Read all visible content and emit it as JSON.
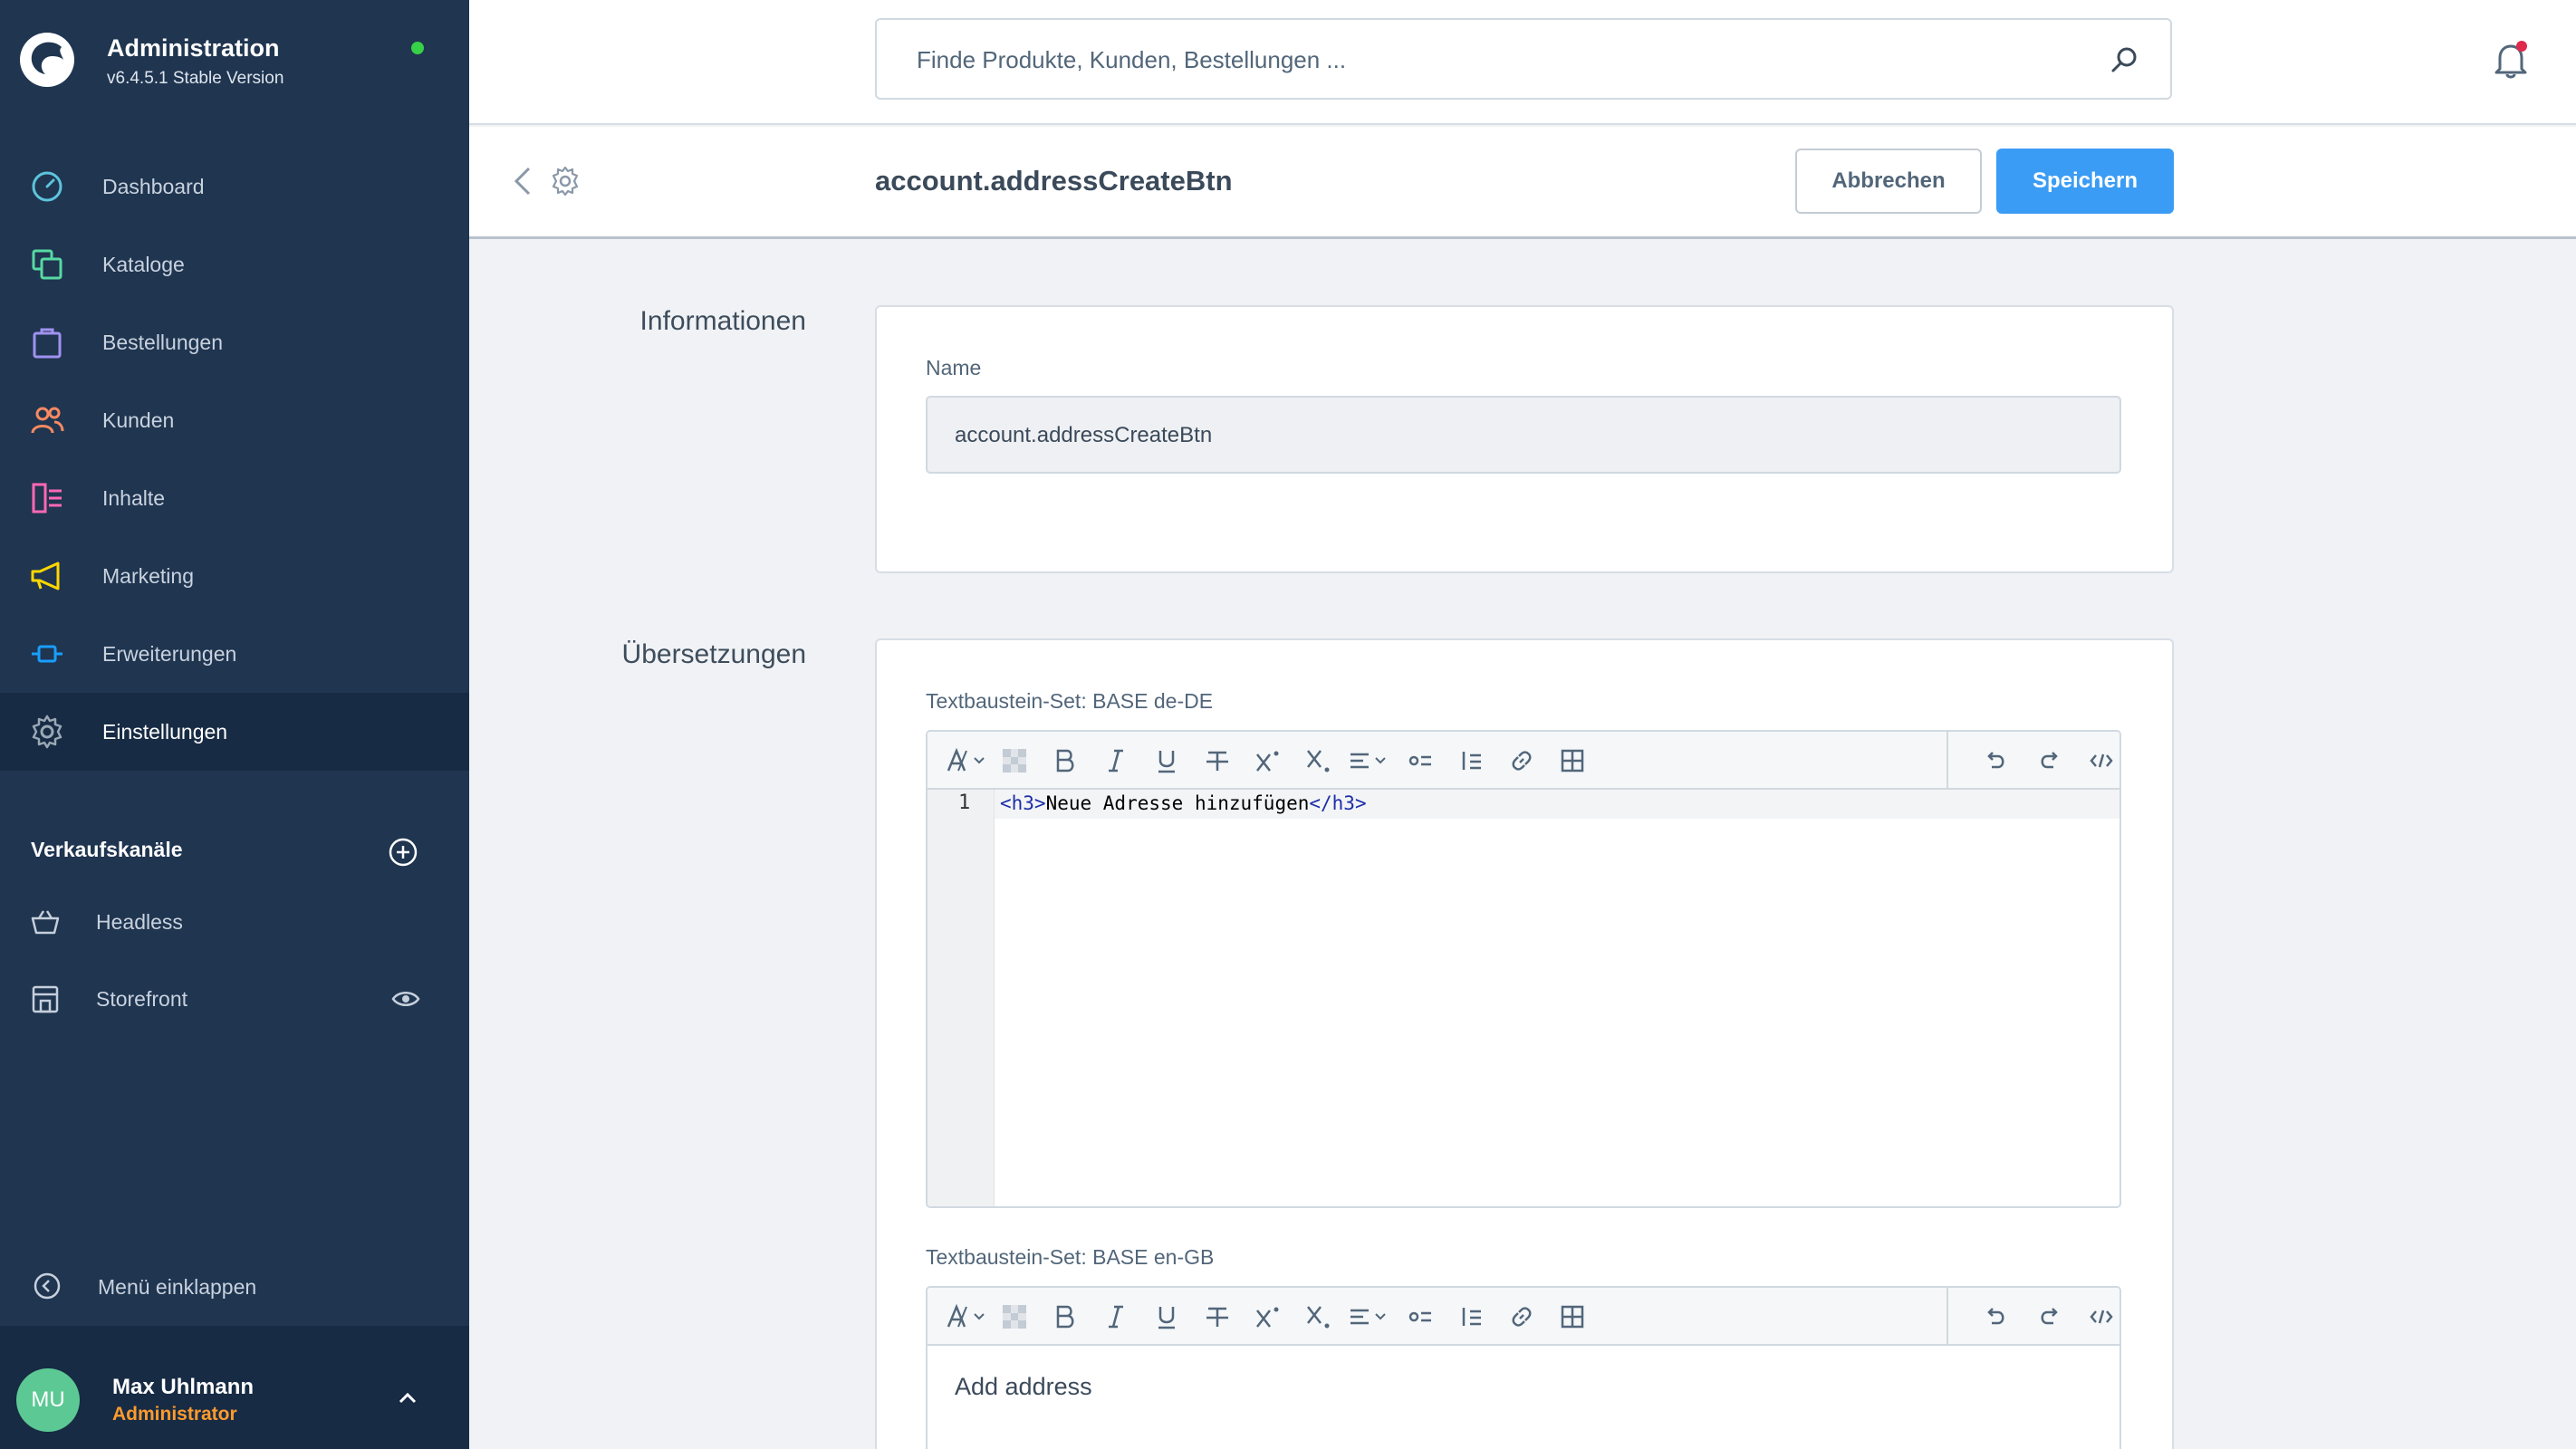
{
  "brand": {
    "title": "Administration",
    "version": "v6.4.5.1 Stable Version",
    "status_color": "#37d046"
  },
  "nav": {
    "items": [
      {
        "label": "Dashboard",
        "icon": "gauge-icon",
        "color": "#5dc4db"
      },
      {
        "label": "Kataloge",
        "icon": "stack-icon",
        "color": "#57d9a3"
      },
      {
        "label": "Bestellungen",
        "icon": "bag-icon",
        "color": "#a092f0"
      },
      {
        "label": "Kunden",
        "icon": "users-icon",
        "color": "#f88962"
      },
      {
        "label": "Inhalte",
        "icon": "content-icon",
        "color": "#ff68b4"
      },
      {
        "label": "Marketing",
        "icon": "megaphone-icon",
        "color": "#ffd700"
      },
      {
        "label": "Erweiterungen",
        "icon": "plug-icon",
        "color": "#189eff"
      },
      {
        "label": "Einstellungen",
        "icon": "gear-icon",
        "color": "#9aa8b5"
      }
    ],
    "active_index": 7
  },
  "channels": {
    "heading": "Verkaufskanäle",
    "items": [
      {
        "label": "Headless",
        "icon": "basket-icon"
      },
      {
        "label": "Storefront",
        "icon": "storefront-icon"
      }
    ]
  },
  "collapse_label": "Menü einklappen",
  "user": {
    "initials": "MU",
    "name": "Max Uhlmann",
    "role": "Administrator"
  },
  "search": {
    "placeholder": "Finde Produkte, Kunden, Bestellungen ..."
  },
  "smartbar": {
    "title": "account.addressCreateBtn",
    "cancel_label": "Abbrechen",
    "save_label": "Speichern",
    "accent": "#3b9cf5"
  },
  "info": {
    "section_label": "Informationen",
    "name_label": "Name",
    "name_value": "account.addressCreateBtn"
  },
  "translations": {
    "section_label": "Übersetzungen",
    "sets": [
      {
        "label": "Textbaustein-Set: BASE de-DE",
        "mode": "code",
        "line_number": "1",
        "code_open": "<h3>",
        "code_text": "Neue Adresse hinzufügen",
        "code_close": "</h3>"
      },
      {
        "label": "Textbaustein-Set: BASE en-GB",
        "mode": "wysiwyg",
        "text": "Add address"
      }
    ]
  }
}
